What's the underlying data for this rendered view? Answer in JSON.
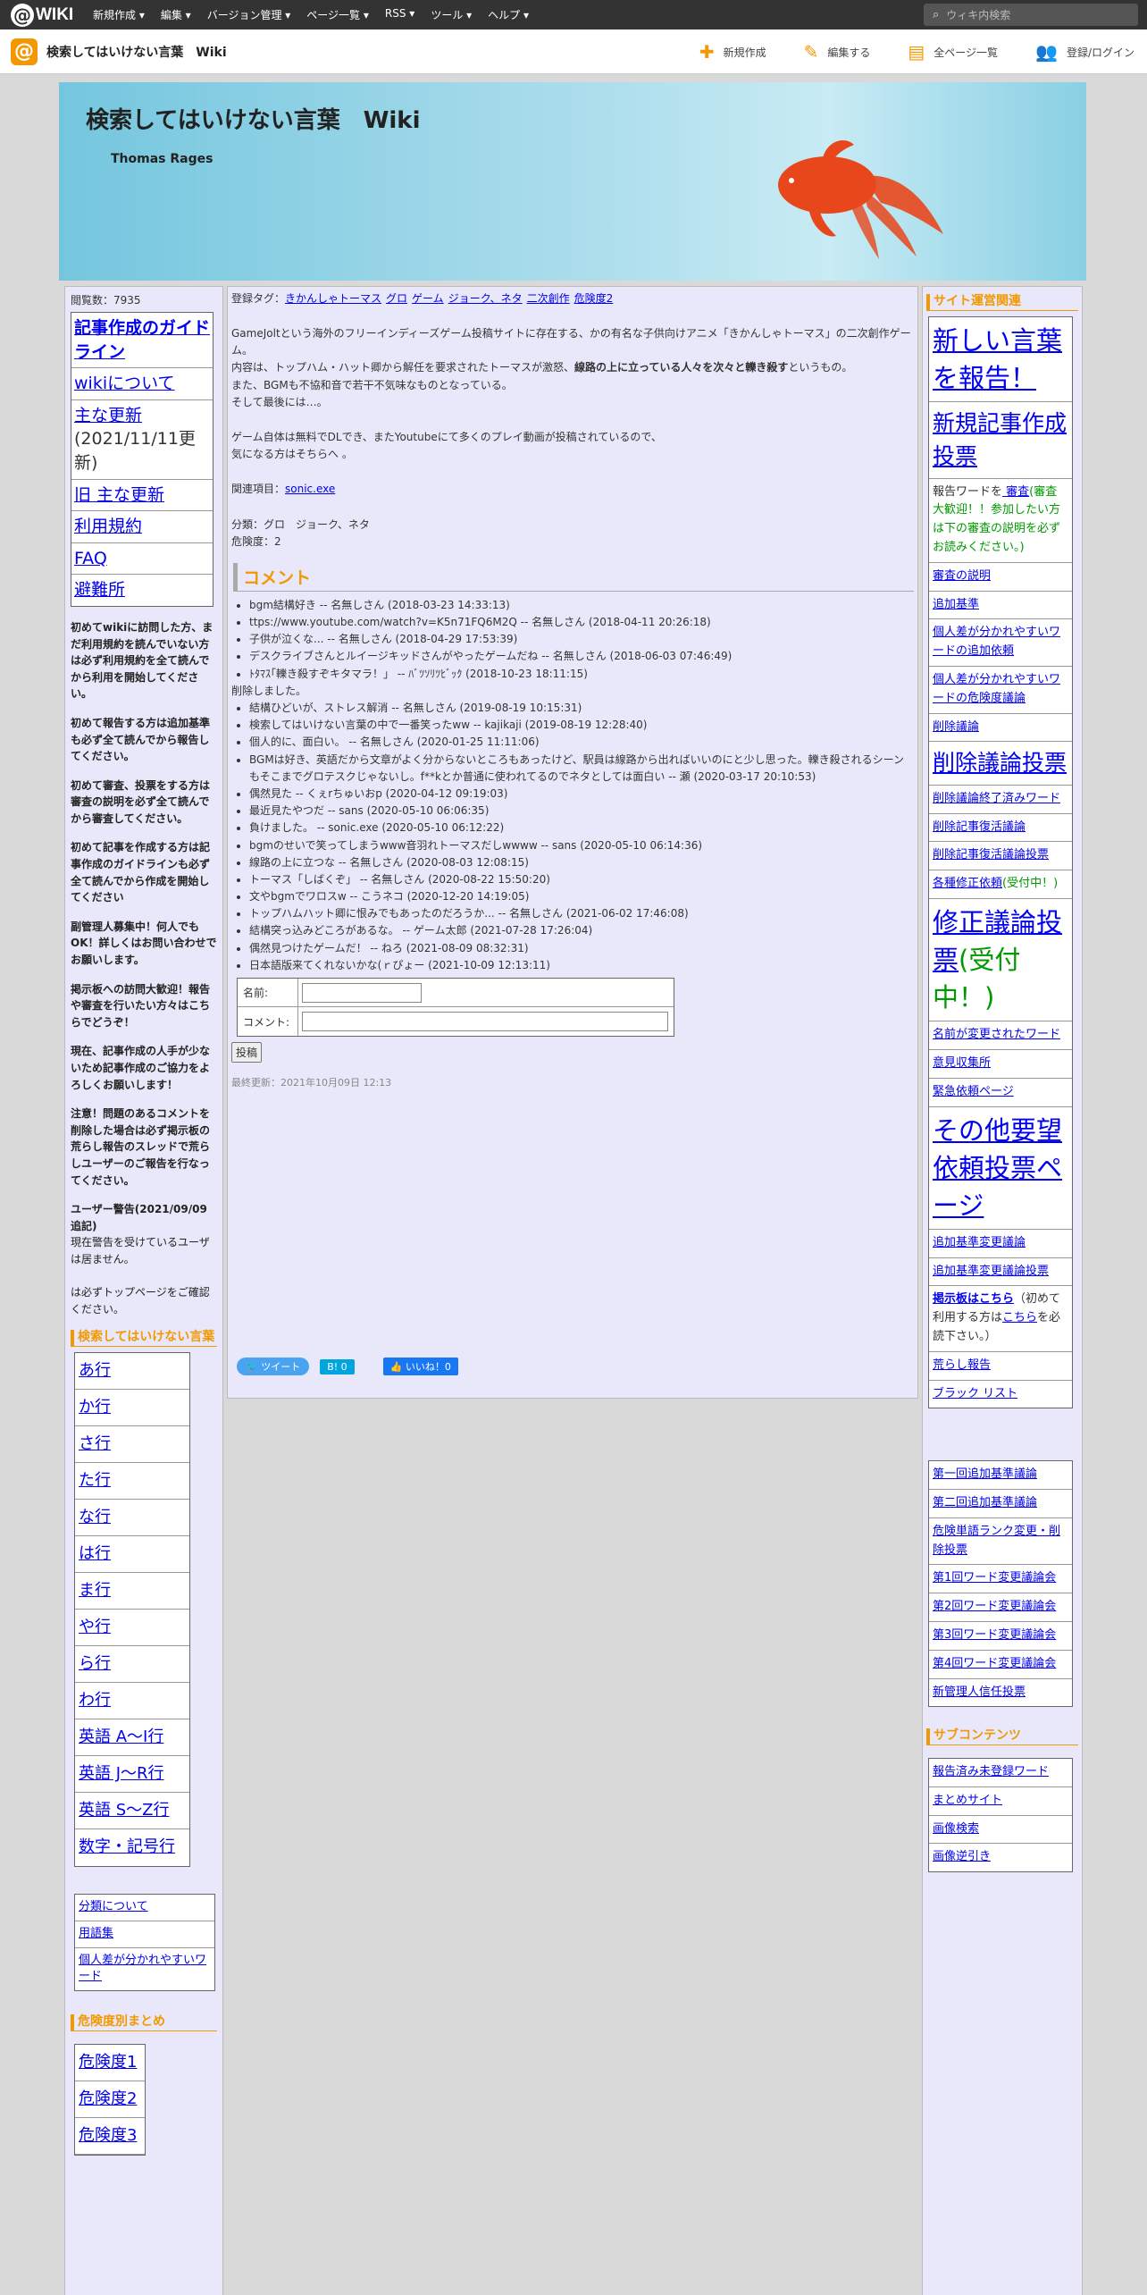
{
  "topbar": {
    "logo_at": "@",
    "logo_text": "WIKI",
    "menus": [
      "新規作成 ▾",
      "編集 ▾",
      "バージョン管理 ▾",
      "ページ一覧 ▾",
      "RSS ▾",
      "ツール ▾",
      "ヘルプ ▾"
    ],
    "search_placeholder": "ウィキ内検索"
  },
  "subbar": {
    "site_title": "検索してはいけない言葉　Wiki",
    "actions": [
      {
        "icon": "plus-icon",
        "glyph": "✚",
        "label": "新規作成"
      },
      {
        "icon": "pencil-icon",
        "glyph": "✎",
        "label": "編集する"
      },
      {
        "icon": "document-icon",
        "glyph": "▤",
        "label": "全ページ一覧"
      },
      {
        "icon": "users-icon",
        "glyph": "👥",
        "label": "登録/ログイン"
      }
    ]
  },
  "banner": {
    "title": "検索してはいけない言葉　Wiki",
    "subtitle": "Thomas Rages"
  },
  "left": {
    "pageviews": "閲覧数：7935",
    "nav": [
      {
        "text": "記事作成のガイドライン",
        "bold": true
      },
      {
        "text": "wikiについて"
      },
      {
        "text": "主な更新",
        "extra": "(2021/11/11更新)"
      },
      {
        "text": "旧 主な更新"
      },
      {
        "text": "利用規約"
      },
      {
        "text": "FAQ"
      },
      {
        "text": "避難所"
      }
    ],
    "notices": [
      "初めてwikiに訪問した方、まだ利用規約を読んでいない方は必ず利用規約を全て読んでから利用を開始してください。",
      "初めて報告する方は追加基準も必ず全て読んでから報告してください。",
      "初めて審査、投票をする方は審査の説明を必ず全て読んでから審査してください。",
      "初めて記事を作成する方は記事作成のガイドラインも必ず全て読んでから作成を開始してください",
      "副管理人募集中！何人でもOK！詳しくはお問い合わせでお願いします。",
      "掲示板への訪問大歓迎！報告や審査を行いたい方々はこちらでどうぞ！",
      "現在、記事作成の人手が少ないため記事作成のご協力をよろしくお願いします！",
      "注意！問題のあるコメントを削除した場合は必ず掲示板の荒らし報告のスレッドで荒らしユーザーのご報告を行なってください。"
    ],
    "warning_title": "ユーザー警告(2021/09/09追記)",
    "warning_body": "現在警告を受けているユーザは居ません。",
    "warning_tail": "は必ずトップページをご確認ください。",
    "section_words": "検索してはいけない言葉",
    "gyo": [
      "あ行",
      "か行",
      "さ行",
      "た行",
      "な行",
      "は行",
      "ま行",
      "や行",
      "ら行",
      "わ行",
      "英語 A〜I行",
      "英語 J〜R行",
      "英語 S〜Z行",
      "数字・記号行"
    ],
    "small_links": [
      "分類について",
      "用語集",
      "個人差が分かれやすいワード"
    ],
    "section_danger": "危険度別まとめ",
    "danger": [
      "危険度1",
      "危険度2",
      "危険度3"
    ]
  },
  "main": {
    "tags_label": "登録タグ：",
    "tags": [
      "きかんしゃトーマス",
      "グロ",
      "ゲーム",
      "ジョーク、ネタ",
      "二次創作",
      "危険度2"
    ],
    "p1": "GameJoltという海外のフリーインディーズゲーム投稿サイトに存在する、かの有名な子供向けアニメ「きかんしゃトーマス」の二次創作ゲーム。",
    "p2a": "内容は、トップハム・ハット卿から解任を要求されたトーマスが激怒、",
    "p2b": "線路の上に立っている人々を次々と轢き殺す",
    "p2c": "というもの。",
    "p3": "また、BGMも不協和音で若干不気味なものとなっている。",
    "p4": "そして最後には…。",
    "p5": "ゲーム自体は無料でDLでき、またYoutubeにて多くのプレイ動画が投稿されているので、",
    "p6": "気になる方はそちらへ 。",
    "related_label": "関連項目：",
    "related_link": "sonic.exe",
    "category": "分類：グロ　ジョーク、ネタ",
    "danger": "危険度：2",
    "comment_heading": "コメント",
    "comments_a": [
      "bgm結構好き -- 名無しさん (2018-03-23 14:33:13)",
      "ttps://www.youtube.com/watch?v=K5n71FQ6M2Q -- 名無しさん (2018-04-11 20:26:18)",
      "子供が泣くな... -- 名無しさん (2018-04-29 17:53:39)",
      "デスクライブさんとルイージキッドさんがやったゲームだね -- 名無しさん (2018-06-03 07:46:49)",
      "ﾄﾀﾏｽ｢轢き殺すぞキタマラ！」 -- ﾊﾞﾂｿﾘﾂﾋﾞｯｸ (2018-10-23 18:11:15)"
    ],
    "deleted": "削除しました。",
    "comments_b": [
      "結構ひどいが、ストレス解消 -- 名無しさん (2019-08-19 10:15:31)",
      "検索してはいけない言葉の中で一番笑ったww -- kajikaji (2019-08-19 12:28:40)",
      "個人的に、面白い。 -- 名無しさん (2020-01-25 11:11:06)",
      "BGMは好き、英語だから文章がよく分からないところもあったけど、駅員は線路から出ればいいのにと少し思った。轢き殺されるシーンもそこまでグロテスクじゃないし。f**kとか普通に使われてるのでネタとしては面白い -- 瀬 (2020-03-17 20:10:53)",
      "偶然見た -- くぇrちゅいおp (2020-04-12 09:19:03)",
      "最近見たやつだ -- sans (2020-05-10 06:06:35)",
      "負けました。 -- sonic.exe (2020-05-10 06:12:22)",
      "bgmのせいで笑ってしまうwww音羽れトーマスだしwwww -- sans (2020-05-10 06:14:36)",
      "線路の上に立つな -- 名無しさん (2020-08-03 12:08:15)",
      "トーマス「しばくぞ」 -- 名無しさん (2020-08-22 15:50:20)",
      "文やbgmでワロスw -- こうネコ (2020-12-20 14:19:05)",
      "トップハムハット卿に恨みでもあったのだろうか... -- 名無しさん (2021-06-02 17:46:08)",
      "結構突っ込みどころがあるな。 -- ゲーム太郎 (2021-07-28 17:26:04)",
      "偶然見つけたゲームだ！ -- ねろ (2021-08-09 08:32:31)",
      "日本語版来てくれないかな(ｒぴょー (2021-10-09 12:13:11)"
    ],
    "form_name": "名前:",
    "form_comment": "コメント:",
    "post_button": "投稿",
    "last_updated": "最終更新：2021年10月09日 12:13",
    "tweet": "ツイート",
    "hatena": "B! 0",
    "like": "いいね！0"
  },
  "right": {
    "section_ops": "サイト運営関連",
    "items": [
      {
        "text": "新しい言葉を報告！",
        "size": "big"
      },
      {
        "text": "新規記事作成投票",
        "size": "mid"
      },
      {
        "pre": "報告ワードを",
        "link": " 審査",
        "post": "(審査大歓迎！！参加したい方は下の審査の説明を必ずお読みください。)",
        "type": "note"
      },
      {
        "text": "審査の説明"
      },
      {
        "text": "追加基準"
      },
      {
        "text": "個人差が分かれやすいワードの追加依頼"
      },
      {
        "text": "個人差が分かれやすいワードの危険度議論"
      },
      {
        "text": "削除議論"
      },
      {
        "text": "削除議論投票",
        "size": "mid"
      },
      {
        "text": "削除議論終了済みワード"
      },
      {
        "text": "削除記事復活議論"
      },
      {
        "text": "削除記事復活議論投票"
      },
      {
        "text": "各種修正依頼",
        "green": "(受付中！)"
      },
      {
        "text": "修正議論投票",
        "green": "(受付中！)",
        "size": "big"
      },
      {
        "text": "名前が変更されたワード"
      },
      {
        "text": "意見収集所"
      },
      {
        "text": "緊急依頼ページ"
      },
      {
        "text": "その他要望依頼投票ページ",
        "size": "big"
      },
      {
        "text": "追加基準変更議論"
      },
      {
        "text": "追加基準変更議論投票"
      },
      {
        "text": "掲示板はこちら",
        "bold": true,
        "tail1": "（初めて利用する方は",
        "link2": "こちら",
        "tail2": "を必読下さい。）"
      },
      {
        "text": "荒らし報告"
      },
      {
        "text": "ブラック リスト"
      }
    ],
    "items2": [
      "第一回追加基準議論",
      "第二回追加基準議論",
      "危険単語ランク変更・削除投票",
      "第1回ワード変更議論会",
      "第2回ワード変更議論会",
      "第3回ワード変更議論会",
      "第4回ワード変更議論会",
      "新管理人信任投票"
    ],
    "section_sub": "サブコンテンツ",
    "items3": [
      "報告済み未登録ワード",
      "まとめサイト",
      "画像検索",
      "画像逆引き"
    ]
  }
}
